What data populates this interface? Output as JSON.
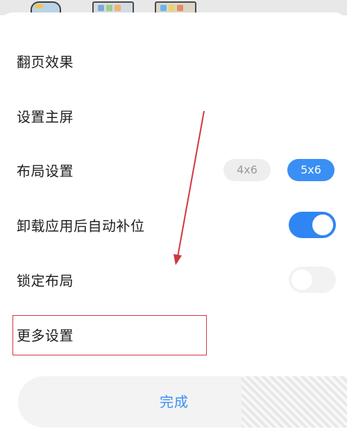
{
  "menu": {
    "page_flip_effect": "翻页效果",
    "set_home_screen": "设置主屏",
    "layout_settings": "布局设置",
    "layout_options": [
      "4x6",
      "5x6"
    ],
    "layout_selected": "5x6",
    "auto_fill_after_uninstall": "卸载应用后自动补位",
    "auto_fill_after_uninstall_enabled": true,
    "lock_layout": "锁定布局",
    "lock_layout_enabled": false,
    "more_settings": "更多设置"
  },
  "done_button": "完成",
  "colors": {
    "accent": "#3a8ff5",
    "annotation_red": "#d2353c"
  },
  "icons": [
    "app-icon",
    "app-folder-icon",
    "app-folder-icon",
    "toggle-knob"
  ]
}
